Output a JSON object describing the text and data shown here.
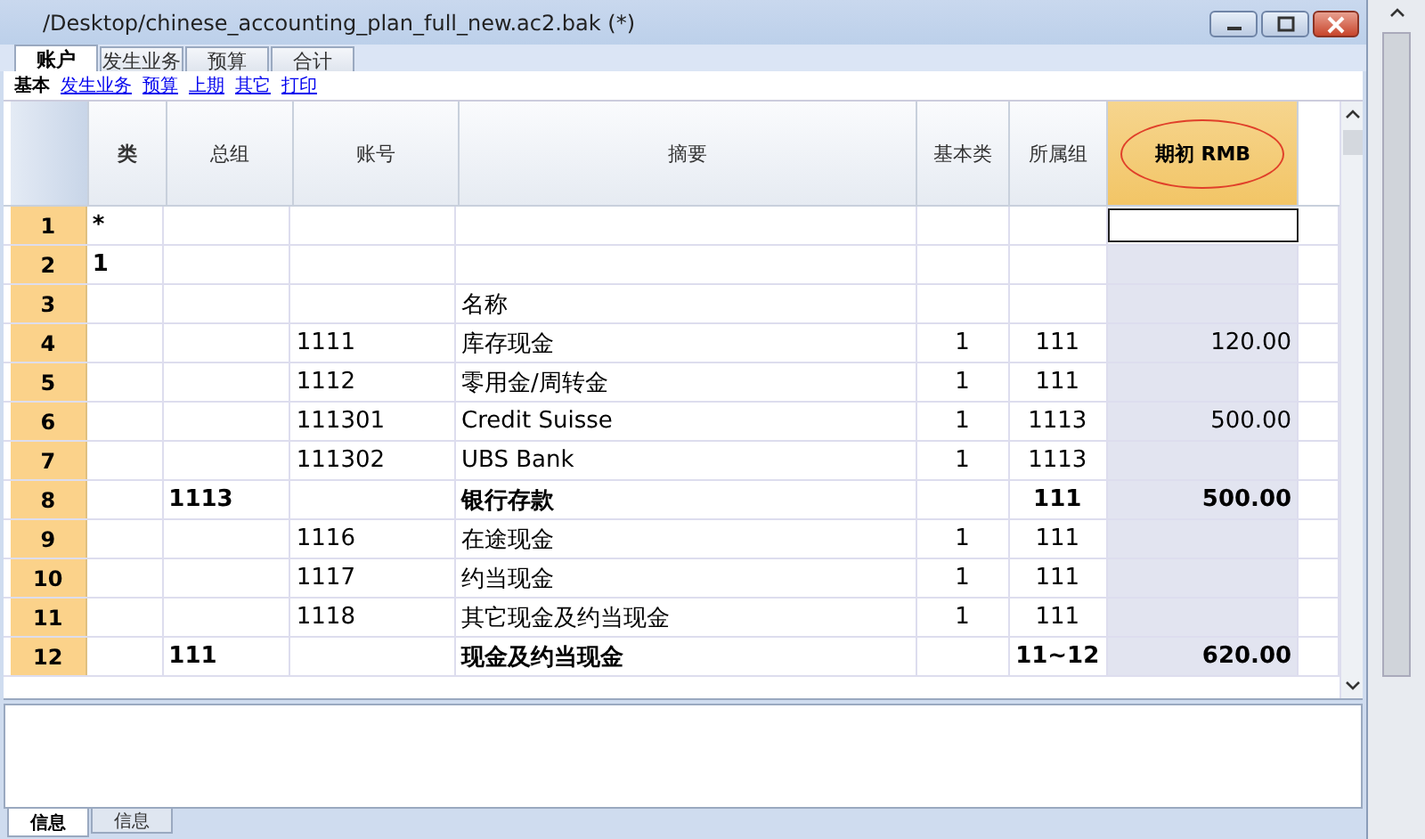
{
  "window": {
    "title": "/Desktop/chinese_accounting_plan_full_new.ac2.bak (*)"
  },
  "tabs": [
    {
      "label": "账户",
      "selected": true
    },
    {
      "label": "发生业务",
      "selected": false
    },
    {
      "label": "预算",
      "selected": false
    },
    {
      "label": "合计",
      "selected": false
    }
  ],
  "views": [
    {
      "label": "基本",
      "selected": true
    },
    {
      "label": "发生业务",
      "selected": false
    },
    {
      "label": "预算",
      "selected": false
    },
    {
      "label": "上期",
      "selected": false
    },
    {
      "label": "其它",
      "selected": false
    },
    {
      "label": "打印",
      "selected": false
    }
  ],
  "table": {
    "columns": [
      {
        "label": "类",
        "highlighted": false
      },
      {
        "label": "总组",
        "highlighted": false
      },
      {
        "label": "账号",
        "highlighted": false
      },
      {
        "label": "摘要",
        "highlighted": false
      },
      {
        "label": "基本类",
        "highlighted": false
      },
      {
        "label": "所属组",
        "highlighted": false
      },
      {
        "label": "期初 RMB",
        "highlighted": true
      }
    ],
    "rows": [
      {
        "number": "1",
        "bold": false,
        "selected": true,
        "cells": [
          "*",
          "",
          "",
          "",
          "",
          "",
          ""
        ]
      },
      {
        "number": "2",
        "bold": true,
        "selected": false,
        "cells": [
          "1",
          "",
          "",
          "",
          "",
          "",
          ""
        ]
      },
      {
        "number": "3",
        "bold": false,
        "selected": false,
        "cells": [
          "",
          "",
          "",
          "名称",
          "",
          "",
          ""
        ]
      },
      {
        "number": "4",
        "bold": false,
        "selected": false,
        "cells": [
          "",
          "",
          "1111",
          "库存现金",
          "1",
          "111",
          "120.00"
        ]
      },
      {
        "number": "5",
        "bold": false,
        "selected": false,
        "cells": [
          "",
          "",
          "1112",
          "零用金/周转金",
          "1",
          "111",
          ""
        ]
      },
      {
        "number": "6",
        "bold": false,
        "selected": false,
        "cells": [
          "",
          "",
          "111301",
          "Credit Suisse",
          "1",
          "1113",
          "500.00"
        ]
      },
      {
        "number": "7",
        "bold": false,
        "selected": false,
        "cells": [
          "",
          "",
          "111302",
          "UBS Bank",
          "1",
          "1113",
          ""
        ]
      },
      {
        "number": "8",
        "bold": true,
        "selected": false,
        "cells": [
          "",
          "1113",
          "",
          "银行存款",
          "",
          "111",
          "500.00"
        ]
      },
      {
        "number": "9",
        "bold": false,
        "selected": false,
        "cells": [
          "",
          "",
          "1116",
          "在途现金",
          "1",
          "111",
          ""
        ]
      },
      {
        "number": "10",
        "bold": false,
        "selected": false,
        "cells": [
          "",
          "",
          "1117",
          "约当现金",
          "1",
          "111",
          ""
        ]
      },
      {
        "number": "11",
        "bold": false,
        "selected": false,
        "cells": [
          "",
          "",
          "1118",
          "其它现金及约当现金",
          "1",
          "111",
          ""
        ]
      },
      {
        "number": "12",
        "bold": true,
        "selected": false,
        "cells": [
          "",
          "111",
          "",
          "现金及约当现金",
          "",
          "11~12",
          "620.00"
        ]
      }
    ]
  },
  "info_tabs": [
    {
      "label": "信息",
      "selected": true
    },
    {
      "label": "信息",
      "selected": false
    }
  ]
}
